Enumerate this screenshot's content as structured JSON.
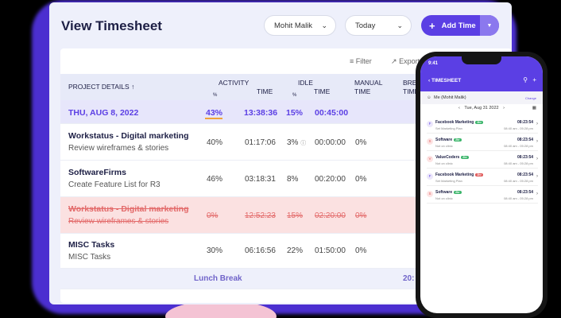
{
  "page": {
    "title": "View Timesheet",
    "user_select": "Mohit Malik",
    "period_select": "Today",
    "add_time_label": "Add Time"
  },
  "toolbar": {
    "filter_label": "Filter",
    "export_label": "Export"
  },
  "table": {
    "headers": {
      "project": "PROJECT DETAILS",
      "activity": "ACTIVITY",
      "activity_pct": "%",
      "activity_time": "TIME",
      "idle": "IDLE",
      "idle_pct": "%",
      "idle_time": "TIME",
      "manual": "MANUAL",
      "manual_time": "TIME",
      "break": "BREA",
      "break_time": "TIME"
    },
    "date_row": {
      "date": "THU, AUG 8, 2022",
      "activity_pct": "43%",
      "activity_time": "13:38:36",
      "idle_pct": "15%",
      "idle_time": "00:45:00"
    },
    "rows": [
      {
        "project": "Workstatus - Digital marketing",
        "task": "Review wireframes & stories",
        "activity_pct": "40%",
        "activity_time": "01:17:06",
        "idle_pct": "3%",
        "idle_time": "00:00:00",
        "manual": "0%"
      },
      {
        "project": "SoftwareFirms",
        "task": "Create Feature List for R3",
        "activity_pct": "46%",
        "activity_time": "03:18:31",
        "idle_pct": "8%",
        "idle_time": "00:20:00",
        "manual": "0%"
      },
      {
        "project": "Workstatus - Digital marketing",
        "task": "Review wireframes & stories",
        "activity_pct": "0%",
        "activity_time": "12:52:23",
        "idle_pct": "15%",
        "idle_time": "02:20:00",
        "manual": "0%"
      },
      {
        "project": "MISC Tasks",
        "task": "MISC Tasks",
        "activity_pct": "30%",
        "activity_time": "06:16:56",
        "idle_pct": "22%",
        "idle_time": "01:50:00",
        "manual": "0%"
      }
    ],
    "lunch": {
      "label": "Lunch Break",
      "break_time": "20:"
    }
  },
  "phone": {
    "status_time": "9:41",
    "title": "TIMESHEET",
    "user": "Me (Mohit Malik)",
    "change": "Change",
    "date": "Tue, Aug 31 2022",
    "items": [
      {
        "name": "Facebook Marketing",
        "badge": "2hr",
        "sub": "Set Marketing Plan",
        "dur": "08:23:54",
        "range": "08:40 am - 05:28 pm",
        "badge_color": "#3bb56a"
      },
      {
        "name": "Software",
        "badge": "2hr",
        "sub": "Not on clinic",
        "dur": "08:23:54",
        "range": "08:40 am - 05:28 pm",
        "badge_color": "#3bb56a"
      },
      {
        "name": "ValueCoders",
        "badge": "2hr",
        "sub": "Not on clinic",
        "dur": "08:23:54",
        "range": "08:40 am - 05:28 pm",
        "badge_color": "#3bb56a"
      },
      {
        "name": "Facebook Marketing",
        "badge": "2hr",
        "sub": "Set Marketing Plan",
        "dur": "08:23:54",
        "range": "08:40 am - 05:28 pm",
        "badge_color": "#e05a5a"
      },
      {
        "name": "Software",
        "badge": "2hr",
        "sub": "Not on clinic",
        "dur": "08:23:54",
        "range": "08:40 am - 05:28 pm",
        "badge_color": "#3bb56a"
      }
    ]
  },
  "colors": {
    "accent": "#5b3fe4",
    "background_glow": "#4b2fd0",
    "struck_row": "#fbe1e1",
    "activity_highlight": "#f0a33a"
  }
}
